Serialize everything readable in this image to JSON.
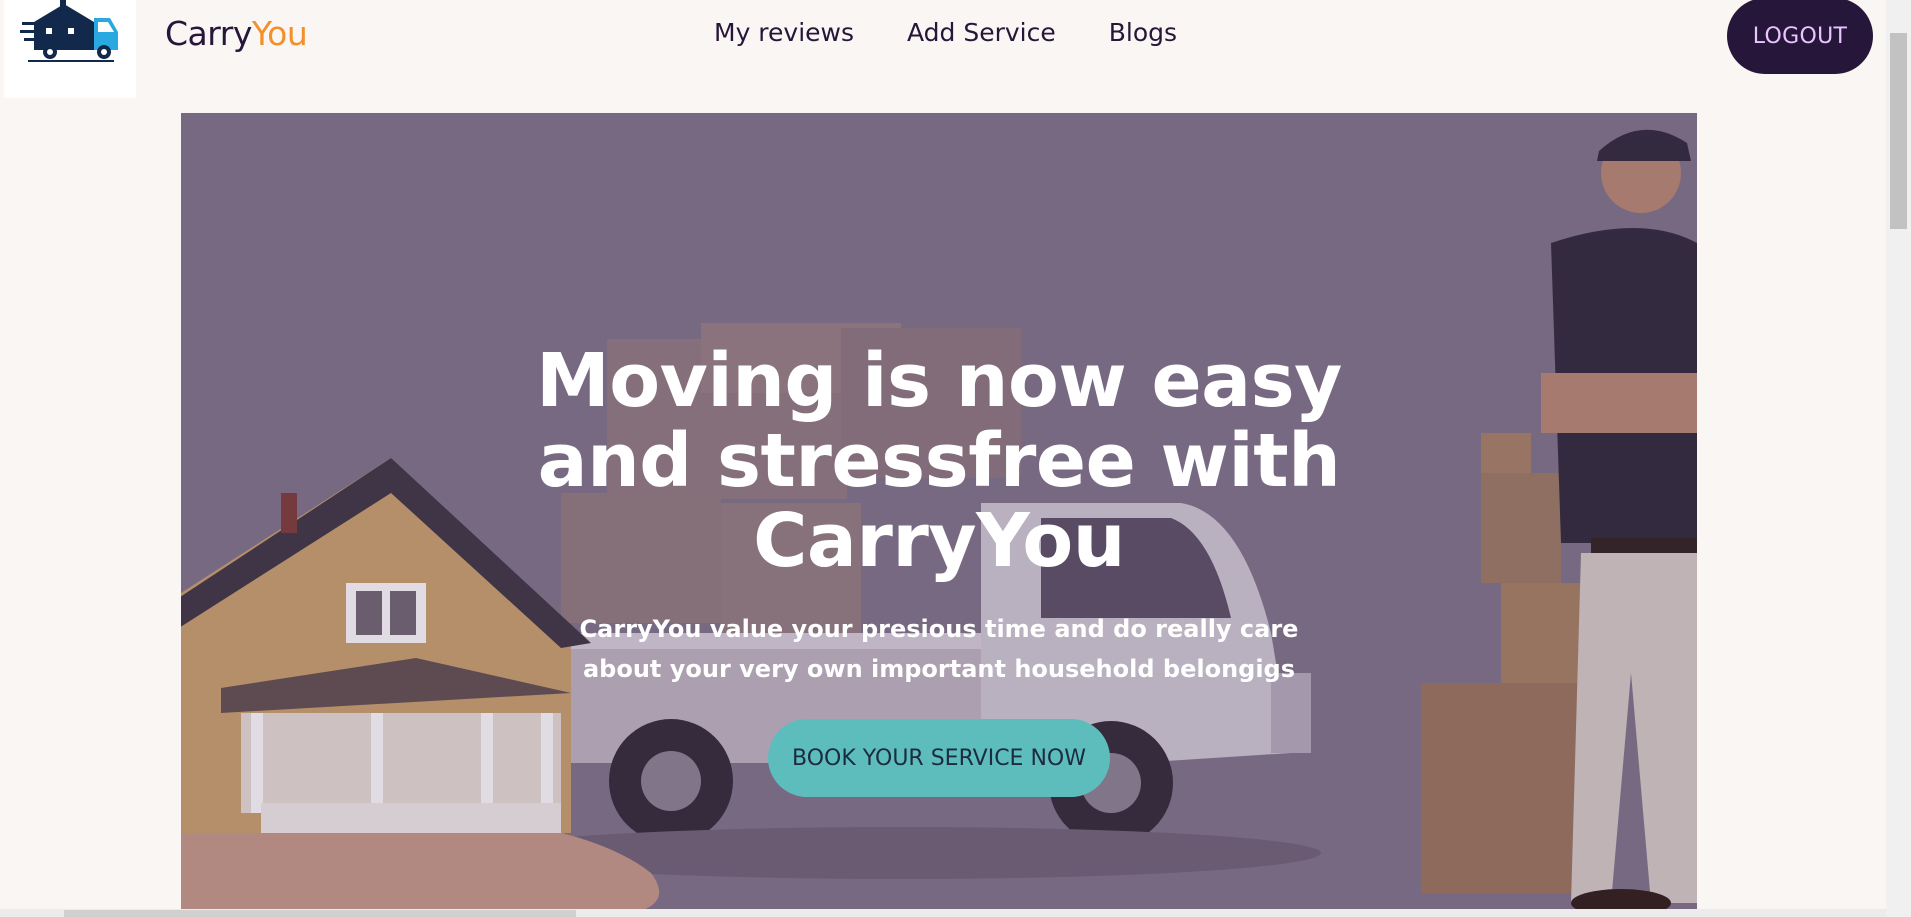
{
  "brand": {
    "name_part1": "Carry",
    "name_part2": "You",
    "accent_color": "#f2912c",
    "logo_icon": "moving-truck-house-logo"
  },
  "nav": {
    "links": [
      {
        "label": "My reviews"
      },
      {
        "label": "Add Service"
      },
      {
        "label": "Blogs"
      }
    ],
    "logout_label": "LOGOUT"
  },
  "hero": {
    "title": "Moving is now easy and stressfree with CarryYou",
    "subtitle": "CarryYou value your presious time and do really care about your very own important household belongigs",
    "cta_label": "BOOK YOUR SERVICE NOW",
    "cta_color": "#5dbdbd",
    "image_description_icon": "house-truck-mover-photo"
  },
  "colors": {
    "primary_dark": "#261639",
    "background": "#faf6f4",
    "logout_text": "#e9c5ff"
  }
}
